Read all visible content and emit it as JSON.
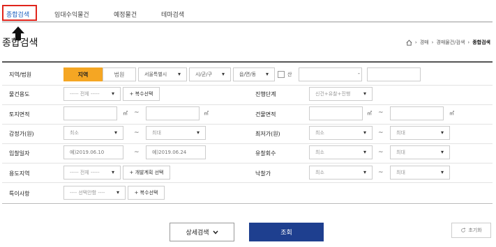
{
  "tabs": [
    {
      "label": "종합검색",
      "active": true
    },
    {
      "label": "임대수익물건"
    },
    {
      "label": "예정물건"
    },
    {
      "label": "테마검색"
    }
  ],
  "page_title": "종합검색",
  "breadcrumb": [
    "경매",
    "경매물건/검색",
    "종합검색"
  ],
  "form": {
    "region": {
      "label": "지역/법원",
      "toggle_region": "지역",
      "toggle_court": "법원",
      "sido": "서울특별시",
      "sigungu": "시/군/구",
      "dong": "읍/면/동",
      "mountain": "산",
      "dash": "-"
    },
    "usage": {
      "label": "물건용도",
      "select": "----- 전체 -----",
      "multi_btn": "+ 복수선택"
    },
    "stage": {
      "label": "진행단계",
      "select": "신건+유찰+진행"
    },
    "land_area": {
      "label": "토지면적",
      "unit": "㎡",
      "tilde": "~"
    },
    "building_area": {
      "label": "건물면적",
      "unit": "㎡",
      "tilde": "~"
    },
    "appraisal": {
      "label": "감정가(원)",
      "min": "최소",
      "max": "최대",
      "tilde": "~"
    },
    "min_price": {
      "label": "최저가(원)",
      "min": "최소",
      "max": "최대",
      "tilde": "~"
    },
    "bid_date": {
      "label": "입찰일자",
      "from_placeholder": "예)2019.06.10",
      "to_placeholder": "예)2019.06.24",
      "tilde": "~"
    },
    "failed_count": {
      "label": "유찰회수",
      "min": "최소",
      "max": "최대",
      "tilde": "~"
    },
    "zoning": {
      "label": "용도지역",
      "select": "----- 전체 -----",
      "plan_btn": "+ 개발계획 선택"
    },
    "winning_price": {
      "label": "낙찰가",
      "min": "최소",
      "max": "최대",
      "tilde": "~"
    },
    "special": {
      "label": "특이사항",
      "select": "---- 선택안함 ----",
      "multi_btn": "+ 복수선택"
    }
  },
  "buttons": {
    "detail": "상세검색",
    "search": "조회",
    "reset": "초기화"
  },
  "colors": {
    "active_tab": "#1b5fbf",
    "highlight": "#e0241b",
    "toggle_on": "#f5a623",
    "search_btn": "#1e3f8f"
  }
}
